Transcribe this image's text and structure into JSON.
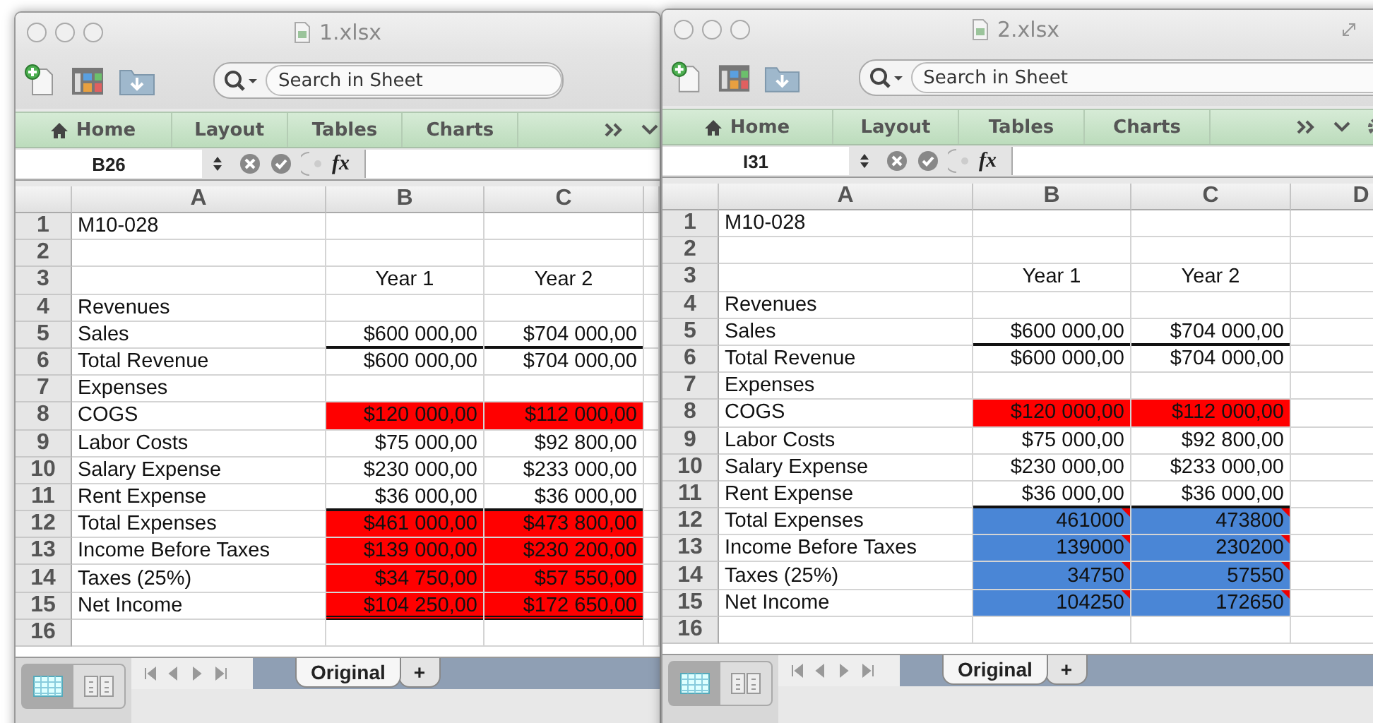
{
  "windows": [
    {
      "title": "1.xlsx",
      "function_button": "fx",
      "search": {
        "placeholder": "Search in Sheet"
      },
      "ribbon_tabs": [
        {
          "label": "Home",
          "kind": "home"
        },
        {
          "label": "Layout"
        },
        {
          "label": "Tables"
        },
        {
          "label": "Charts"
        }
      ],
      "name_box": "B26",
      "columns": [
        "A",
        "B",
        "C"
      ],
      "rows": [
        {
          "number": "1",
          "cells": [
            {
              "text": "M10-028"
            }
          ]
        },
        {
          "number": "2"
        },
        {
          "number": "3",
          "cells": [
            {},
            {
              "text": "Year 1",
              "kind": "heading"
            },
            {
              "text": "Year 2",
              "kind": "heading"
            }
          ]
        },
        {
          "number": "4",
          "cells": [
            {
              "text": "Revenues"
            }
          ]
        },
        {
          "number": "5",
          "cells": [
            {
              "text": "Sales"
            },
            {
              "text": "$600 000,00",
              "kind": "number",
              "bottom_rule": true
            },
            {
              "text": "$704 000,00",
              "kind": "number",
              "bottom_rule": true
            }
          ]
        },
        {
          "number": "6",
          "cells": [
            {
              "text": "Total Revenue"
            },
            {
              "text": "$600 000,00",
              "kind": "number"
            },
            {
              "text": "$704 000,00",
              "kind": "number"
            }
          ]
        },
        {
          "number": "7",
          "cells": [
            {
              "text": "Expenses"
            }
          ]
        },
        {
          "number": "8",
          "cells": [
            {
              "text": "COGS"
            },
            {
              "text": "$120 000,00",
              "kind": "number",
              "color": "#ff0000"
            },
            {
              "text": "$112 000,00",
              "kind": "number",
              "color": "#ff0000"
            }
          ]
        },
        {
          "number": "9",
          "cells": [
            {
              "text": "Labor Costs"
            },
            {
              "text": "$75 000,00",
              "kind": "number"
            },
            {
              "text": "$92 800,00",
              "kind": "number"
            }
          ]
        },
        {
          "number": "10",
          "cells": [
            {
              "text": "Salary Expense"
            },
            {
              "text": "$230 000,00",
              "kind": "number"
            },
            {
              "text": "$233 000,00",
              "kind": "number"
            }
          ]
        },
        {
          "number": "11",
          "cells": [
            {
              "text": "Rent Expense"
            },
            {
              "text": "$36 000,00",
              "kind": "number",
              "bottom_rule": true
            },
            {
              "text": "$36 000,00",
              "kind": "number",
              "bottom_rule": true
            }
          ]
        },
        {
          "number": "12",
          "cells": [
            {
              "text": "Total Expenses"
            },
            {
              "text": "$461 000,00",
              "kind": "number",
              "color": "#ff0000"
            },
            {
              "text": "$473 800,00",
              "kind": "number",
              "color": "#ff0000"
            }
          ]
        },
        {
          "number": "13",
          "cells": [
            {
              "text": "Income Before Taxes"
            },
            {
              "text": "$139 000,00",
              "kind": "number",
              "color": "#ff0000"
            },
            {
              "text": "$230 200,00",
              "kind": "number",
              "color": "#ff0000"
            }
          ]
        },
        {
          "number": "14",
          "cells": [
            {
              "text": "Taxes (25%)"
            },
            {
              "text": "$34 750,00",
              "kind": "number",
              "color": "#ff0000"
            },
            {
              "text": "$57 550,00",
              "kind": "number",
              "color": "#ff0000"
            }
          ]
        },
        {
          "number": "15",
          "cells": [
            {
              "text": "Net Income"
            },
            {
              "text": "$104 250,00",
              "kind": "number",
              "color": "#ff0000",
              "double_rule": true
            },
            {
              "text": "$172 650,00",
              "kind": "number",
              "color": "#ff0000",
              "double_rule": true
            }
          ]
        },
        {
          "number": "16"
        }
      ],
      "view_buttons": [
        {
          "kind": "normal",
          "selected": true
        },
        {
          "kind": "page-layout",
          "selected": false
        }
      ],
      "sheet_tabs": [
        {
          "label": "Original",
          "selected": true
        },
        {
          "label": "+",
          "selected": false
        }
      ]
    },
    {
      "title": "2.xlsx",
      "function_button": "fx",
      "search": {
        "placeholder": "Search in Sheet"
      },
      "ribbon_tabs": [
        {
          "label": "Home",
          "kind": "home"
        },
        {
          "label": "Layout"
        },
        {
          "label": "Tables"
        },
        {
          "label": "Charts"
        }
      ],
      "name_box": "I31",
      "columns": [
        "A",
        "B",
        "C",
        "D"
      ],
      "rows": [
        {
          "number": "1",
          "cells": [
            {
              "text": "M10-028"
            }
          ]
        },
        {
          "number": "2"
        },
        {
          "number": "3",
          "cells": [
            {},
            {
              "text": "Year 1",
              "kind": "heading"
            },
            {
              "text": "Year 2",
              "kind": "heading"
            }
          ]
        },
        {
          "number": "4",
          "cells": [
            {
              "text": "Revenues"
            }
          ]
        },
        {
          "number": "5",
          "cells": [
            {
              "text": "Sales"
            },
            {
              "text": "$600 000,00",
              "kind": "number",
              "bottom_rule": true
            },
            {
              "text": "$704 000,00",
              "kind": "number",
              "bottom_rule": true
            }
          ]
        },
        {
          "number": "6",
          "cells": [
            {
              "text": "Total Revenue"
            },
            {
              "text": "$600 000,00",
              "kind": "number"
            },
            {
              "text": "$704 000,00",
              "kind": "number"
            }
          ]
        },
        {
          "number": "7",
          "cells": [
            {
              "text": "Expenses"
            }
          ]
        },
        {
          "number": "8",
          "cells": [
            {
              "text": "COGS"
            },
            {
              "text": "$120 000,00",
              "kind": "number",
              "color": "#ff0000"
            },
            {
              "text": "$112 000,00",
              "kind": "number",
              "color": "#ff0000"
            }
          ]
        },
        {
          "number": "9",
          "cells": [
            {
              "text": "Labor Costs"
            },
            {
              "text": "$75 000,00",
              "kind": "number"
            },
            {
              "text": "$92 800,00",
              "kind": "number"
            }
          ]
        },
        {
          "number": "10",
          "cells": [
            {
              "text": "Salary Expense"
            },
            {
              "text": "$230 000,00",
              "kind": "number"
            },
            {
              "text": "$233 000,00",
              "kind": "number"
            }
          ]
        },
        {
          "number": "11",
          "cells": [
            {
              "text": "Rent Expense"
            },
            {
              "text": "$36 000,00",
              "kind": "number",
              "bottom_rule": true
            },
            {
              "text": "$36 000,00",
              "kind": "number",
              "bottom_rule": true
            }
          ]
        },
        {
          "number": "12",
          "cells": [
            {
              "text": "Total Expenses"
            },
            {
              "text": "461000",
              "kind": "number",
              "color": "#4a86d6",
              "comment": true
            },
            {
              "text": "473800",
              "kind": "number",
              "color": "#4a86d6",
              "comment": true
            }
          ]
        },
        {
          "number": "13",
          "cells": [
            {
              "text": "Income Before Taxes"
            },
            {
              "text": "139000",
              "kind": "number",
              "color": "#4a86d6",
              "comment": true
            },
            {
              "text": "230200",
              "kind": "number",
              "color": "#4a86d6",
              "comment": true
            }
          ]
        },
        {
          "number": "14",
          "cells": [
            {
              "text": "Taxes (25%)"
            },
            {
              "text": "34750",
              "kind": "number",
              "color": "#4a86d6",
              "comment": true
            },
            {
              "text": "57550",
              "kind": "number",
              "color": "#4a86d6",
              "comment": true
            }
          ]
        },
        {
          "number": "15",
          "cells": [
            {
              "text": "Net Income"
            },
            {
              "text": "104250",
              "kind": "number",
              "color": "#4a86d6",
              "comment": true
            },
            {
              "text": "172650",
              "kind": "number",
              "color": "#4a86d6",
              "comment": true
            }
          ]
        },
        {
          "number": "16"
        }
      ],
      "view_buttons": [
        {
          "kind": "normal",
          "selected": true
        },
        {
          "kind": "page-layout",
          "selected": false
        }
      ],
      "sheet_tabs": [
        {
          "label": "Original",
          "selected": true
        },
        {
          "label": "+",
          "selected": false
        }
      ]
    }
  ]
}
